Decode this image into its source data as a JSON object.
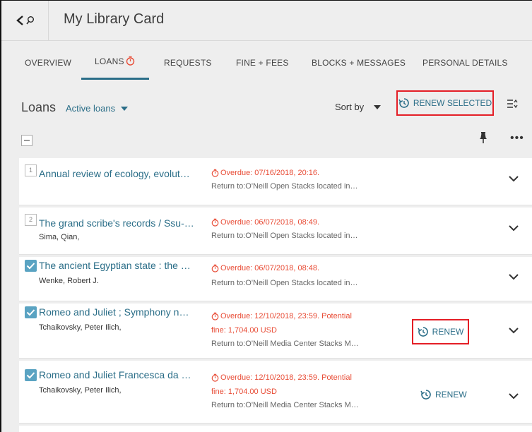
{
  "header": {
    "title": "My Library Card"
  },
  "tabs": [
    {
      "label": "OVERVIEW"
    },
    {
      "label": "LOANS"
    },
    {
      "label": "REQUESTS"
    },
    {
      "label": "FINE + FEES"
    },
    {
      "label": "BLOCKS + MESSAGES"
    },
    {
      "label": "PERSONAL DETAILS"
    }
  ],
  "loans": {
    "title": "Loans",
    "filter": "Active loans",
    "sort_label": "Sort by",
    "renew_selected": "RENEW SELECTED"
  },
  "items": [
    {
      "index": "1",
      "checked": false,
      "title": "Annual review of ecology, evolut…",
      "author": "",
      "overdue": "Overdue: 07/16/2018, 20:16.",
      "overdue2": "",
      "return_to": "Return to:O'Neill Open Stacks located in…",
      "renew": ""
    },
    {
      "index": "2",
      "checked": false,
      "title": "The grand scribe's records / Ssu-…",
      "author": "Sima, Qian,",
      "overdue": "Overdue: 06/07/2018, 08:49.",
      "overdue2": "",
      "return_to": "Return to:O'Neill Open Stacks located in…",
      "renew": ""
    },
    {
      "index": "",
      "checked": true,
      "title": "The ancient Egyptian state : the …",
      "author": "Wenke, Robert J.",
      "overdue": "Overdue: 06/07/2018, 08:48.",
      "overdue2": "",
      "return_to": "Return to:O'Neill Open Stacks located in…",
      "renew": ""
    },
    {
      "index": "",
      "checked": true,
      "title": "Romeo and Juliet ; Symphony n…",
      "author": "Tchaikovsky, Peter Ilich,",
      "overdue": "Overdue: 12/10/2018, 23:59. Potential",
      "overdue2": "fine: 1,704.00 USD",
      "return_to": "Return to:O'Neill Media Center Stacks M…",
      "renew": "RENEW"
    },
    {
      "index": "",
      "checked": true,
      "title": "Romeo and Juliet Francesca da …",
      "author": "Tchaikovsky, Peter Ilich,",
      "overdue": "Overdue: 12/10/2018, 23:59. Potential",
      "overdue2": "fine: 1,704.00 USD",
      "return_to": "Return to:O'Neill Media Center Stacks M…",
      "renew": "RENEW"
    }
  ],
  "colors": {
    "accent": "#2b6e88",
    "overdue": "#e84c36",
    "highlight": "#e41e26",
    "checkbox": "#5aa3c2"
  }
}
